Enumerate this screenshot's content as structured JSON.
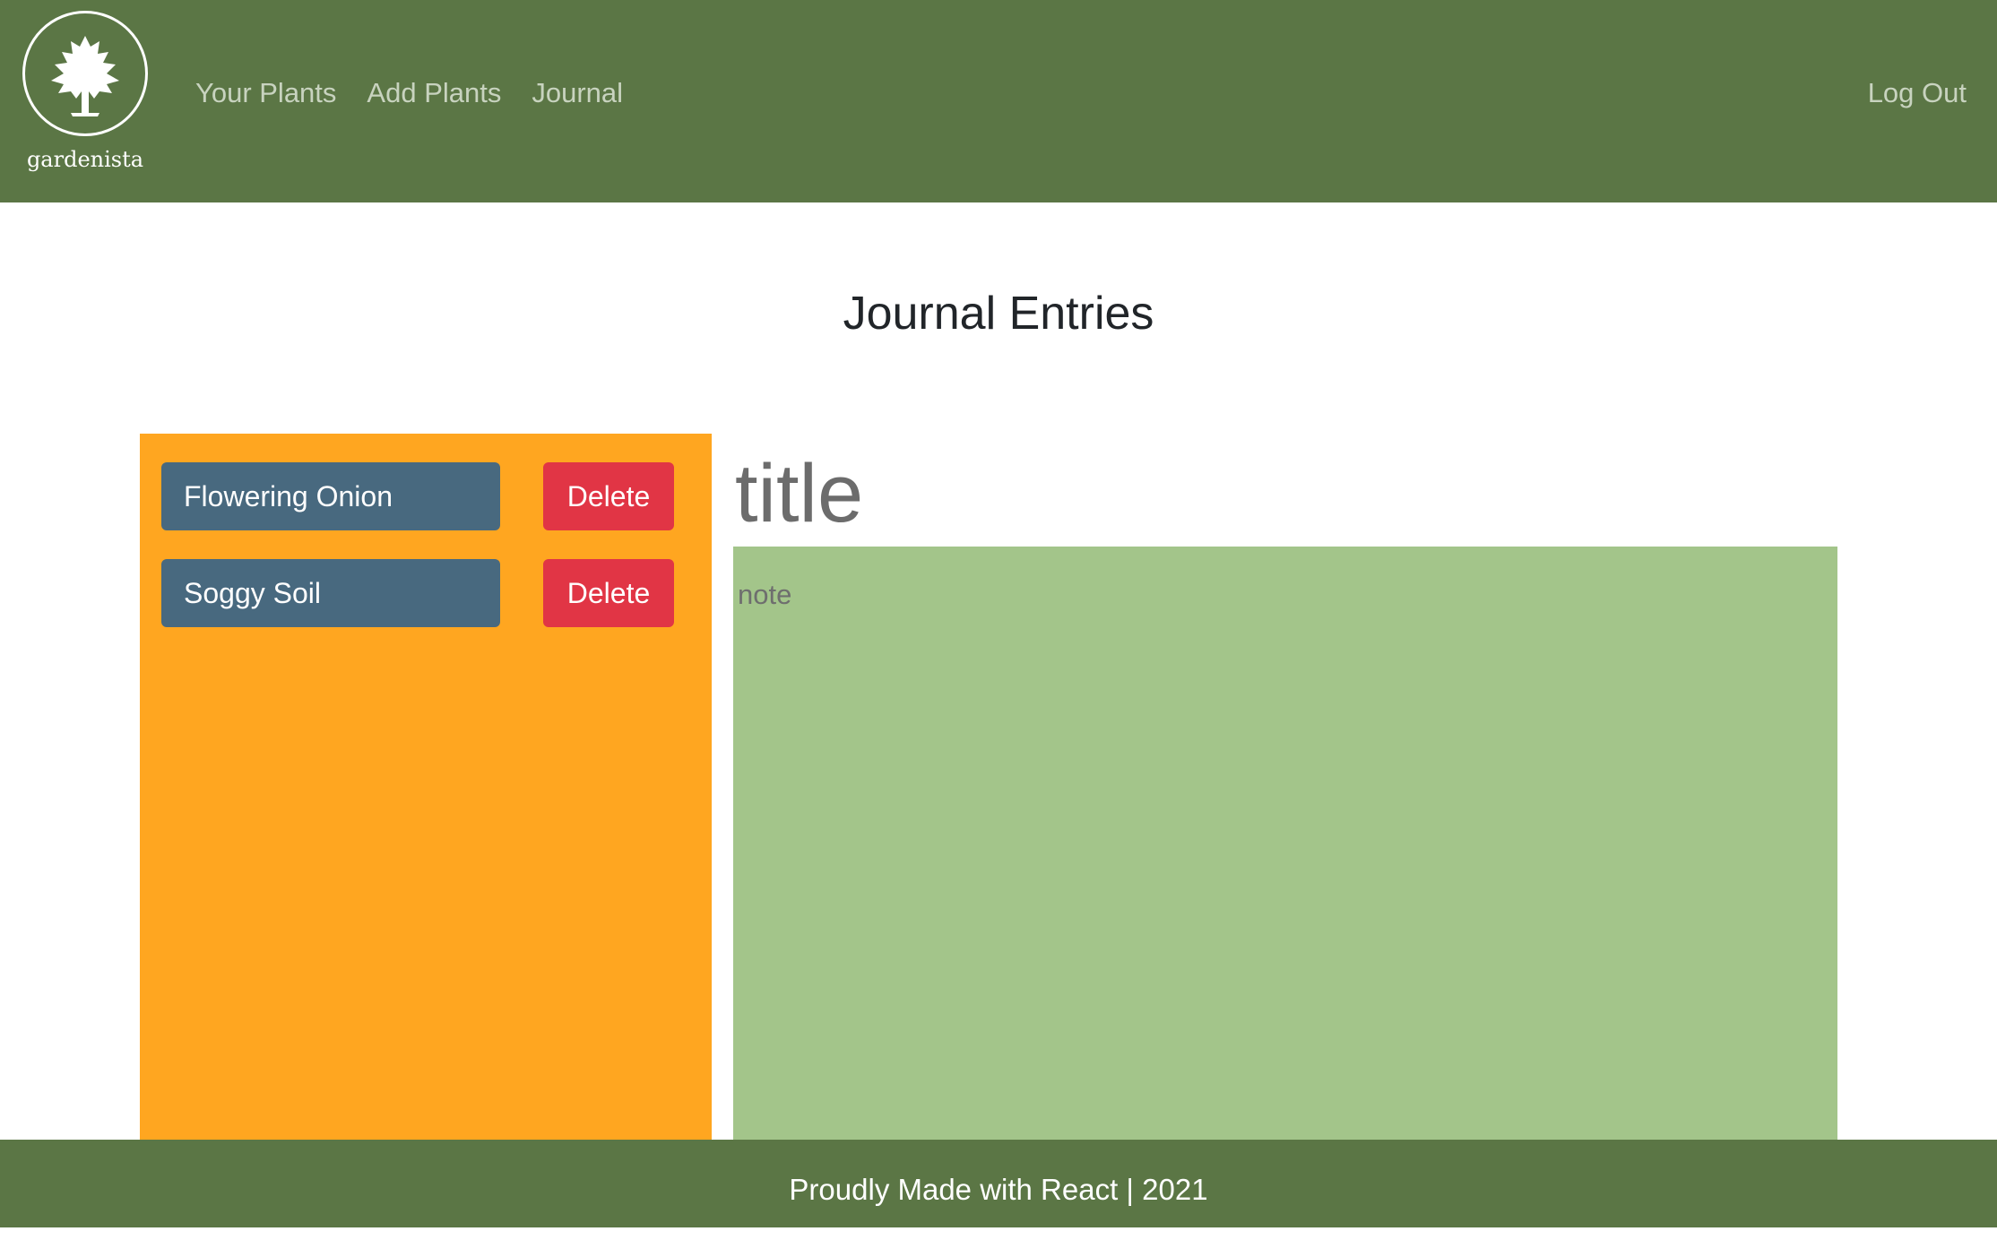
{
  "navbar": {
    "brand_name": "gardenista",
    "logo_icon": "tree-icon",
    "links": [
      {
        "label": "Your Plants"
      },
      {
        "label": "Add Plants"
      },
      {
        "label": "Journal"
      }
    ],
    "logout_label": "Log Out"
  },
  "main": {
    "page_title": "Journal Entries",
    "entries": [
      {
        "title": "Flowering Onion",
        "delete_label": "Delete"
      },
      {
        "title": "Soggy Soil",
        "delete_label": "Delete"
      }
    ],
    "editor": {
      "title_placeholder": "title",
      "note_placeholder": "note"
    }
  },
  "footer": {
    "text": "Proudly Made with React | 2021"
  },
  "colors": {
    "navbar_bg": "#5b7645",
    "entries_panel_bg": "#ffa620",
    "entry_button_bg": "#48697f",
    "delete_button_bg": "#e13545",
    "note_area_bg": "#a3c58a"
  }
}
